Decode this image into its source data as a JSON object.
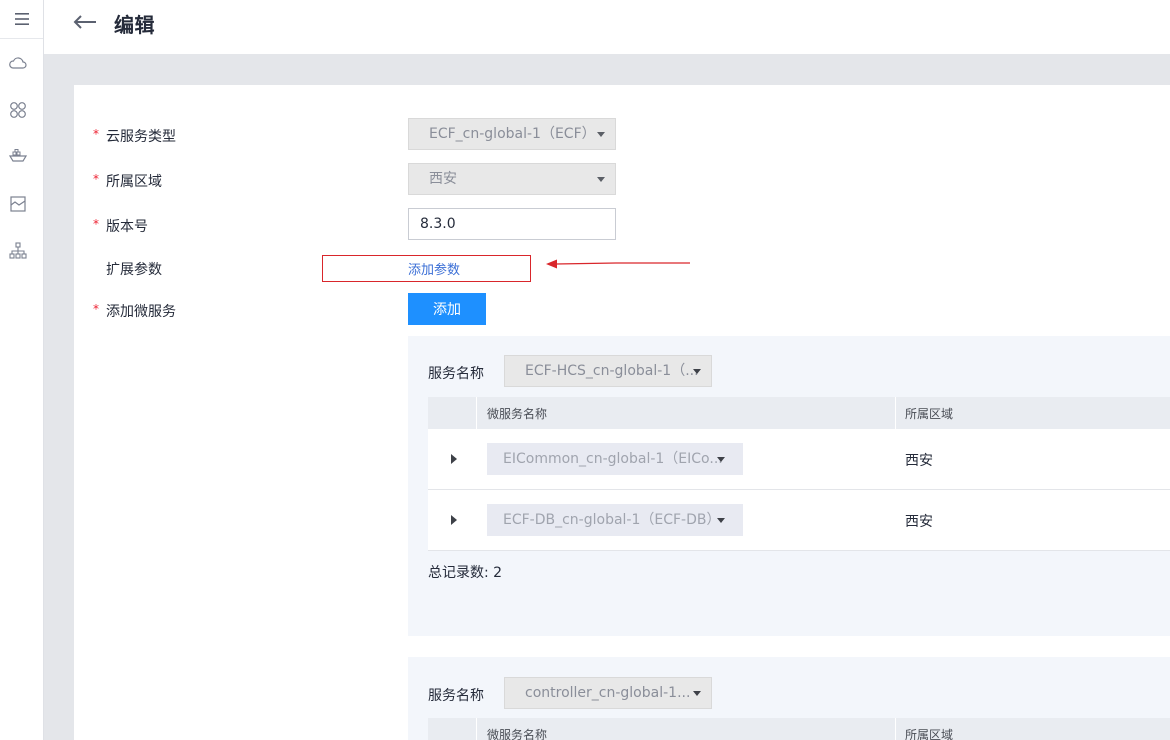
{
  "rail": {
    "icons": [
      "menu-icon",
      "cloud-icon",
      "apps-icon",
      "ship-icon",
      "chart-icon",
      "topology-icon"
    ]
  },
  "header": {
    "title": "编辑"
  },
  "form": {
    "required_mark": "*",
    "service_type_label": "云服务类型",
    "service_type_value": "ECF_cn-global-1（ECF）",
    "region_label": "所属区域",
    "region_value": "西安",
    "version_label": "版本号",
    "version_value": "8.3.0",
    "ext_params_label": "扩展参数",
    "add_param_link": "添加参数",
    "microservice_label": "添加微服务",
    "add_button": "添加"
  },
  "panels": [
    {
      "service_label": "服务名称",
      "service_value": "ECF-HCS_cn-global-1（...",
      "columns": [
        "微服务名称",
        "所属区域"
      ],
      "rows": [
        {
          "name": "EICommon_cn-global-1（EICo...",
          "region": "西安"
        },
        {
          "name": "ECF-DB_cn-global-1（ECF-DB）",
          "region": "西安"
        }
      ],
      "total": "总记录数: 2"
    },
    {
      "service_label": "服务名称",
      "service_value": "controller_cn-global-1...",
      "columns": [
        "微服务名称",
        "所属区域"
      ]
    }
  ],
  "colors": {
    "primary": "#1e90ff",
    "link": "#3b6fd6",
    "annotation": "#d9262b",
    "required": "#ee2233"
  }
}
